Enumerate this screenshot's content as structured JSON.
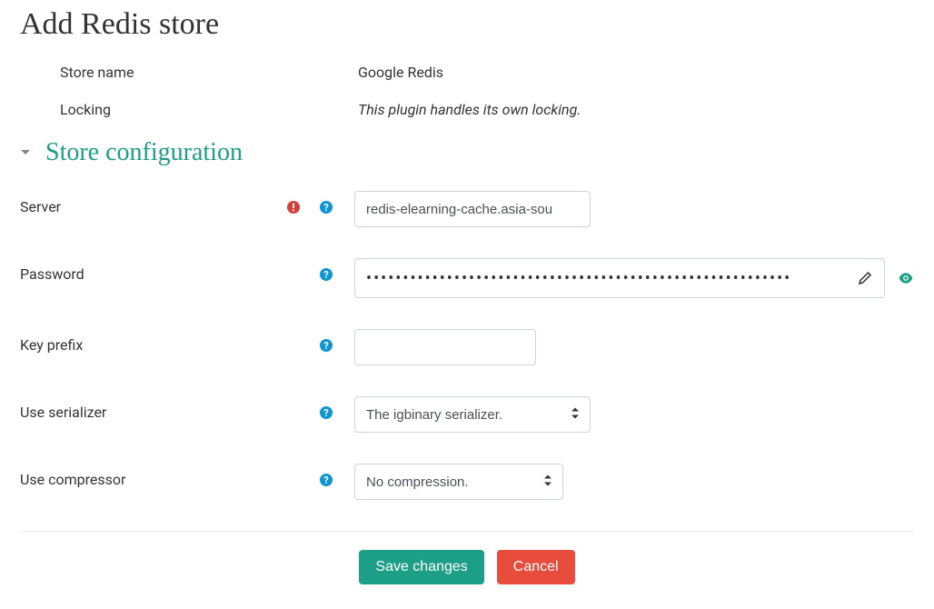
{
  "page": {
    "title": "Add Redis store"
  },
  "info": {
    "store_name_label": "Store name",
    "store_name_value": "Google Redis",
    "locking_label": "Locking",
    "locking_value": "This plugin handles its own locking."
  },
  "section": {
    "title": "Store configuration"
  },
  "fields": {
    "server": {
      "label": "Server",
      "value": "redis-elearning-cache.asia-sou"
    },
    "password": {
      "label": "Password",
      "mask": "••••••••••••••••••••••••••••••••••••••••••••••••••••••••••"
    },
    "key_prefix": {
      "label": "Key prefix",
      "value": ""
    },
    "serializer": {
      "label": "Use serializer",
      "selected": "The igbinary serializer."
    },
    "compressor": {
      "label": "Use compressor",
      "selected": "No compression."
    }
  },
  "buttons": {
    "save": "Save changes",
    "cancel": "Cancel"
  }
}
